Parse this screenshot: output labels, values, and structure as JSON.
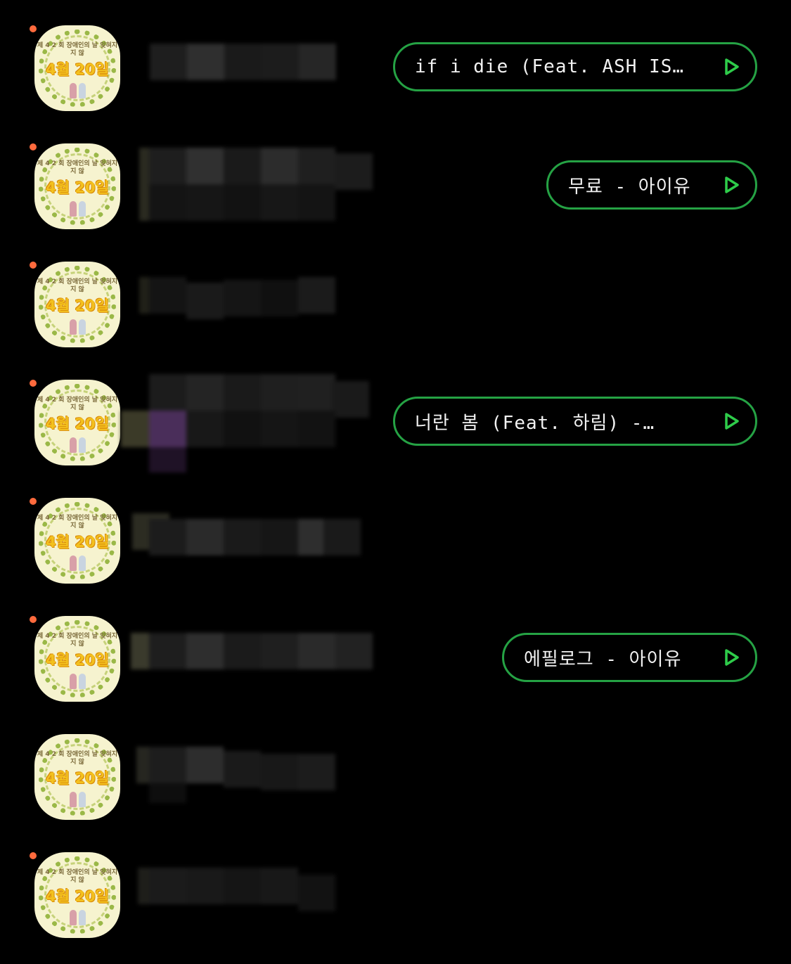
{
  "avatar": {
    "caption": "제 4 2 회 장애인의 날 잊혀지지 않",
    "date": "4월 20일",
    "name": "orange-dot-unread-badge"
  },
  "rows": [
    {
      "song": "if i die (Feat. ASH IS…"
    },
    {
      "song": "무료 - 아이유"
    },
    {
      "song": ""
    },
    {
      "song": "너란 봄 (Feat. 하림) -…"
    },
    {
      "song": ""
    },
    {
      "song": "에필로그 - 아이유"
    },
    {
      "song": ""
    },
    {
      "song": ""
    }
  ],
  "colors": {
    "background": "#000000",
    "pill_border": "#25a244",
    "badge": "#ff6a3d",
    "play_icon": "#2ecc4a"
  },
  "icons": {
    "play": "play-icon"
  }
}
